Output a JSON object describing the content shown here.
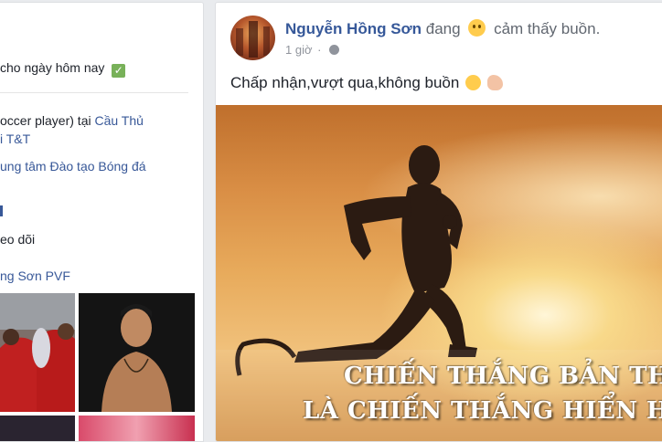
{
  "intro": {
    "rows": [
      {
        "text": "cho ngày hôm nay"
      },
      {
        "prefix": "occer player) tại ",
        "link": "Cầu Thủ"
      },
      {
        "link": "i T&T"
      },
      {
        "link": "ung tâm Đào tạo Bóng đá"
      },
      {
        "text": "eo dõi"
      },
      {
        "link": "ng Sơn PVF"
      }
    ]
  },
  "post": {
    "author": "Nguyễn Hồng Sơn",
    "feeling_prefix": "đang",
    "feeling": "cảm thấy buồn.",
    "timestamp": "1 giờ",
    "privacy_icon": "globe-icon",
    "status": "Chấp nhận,vượt qua,không buồn",
    "image_caption_line1": "CHIẾN THẮNG BẢN THÂN",
    "image_caption_line2": "LÀ CHIẾN THẮNG HIỂN HÁCH"
  },
  "colors": {
    "link": "#385898",
    "author": "#365899",
    "check": "#78b159",
    "page_bg": "#e9ebee"
  }
}
